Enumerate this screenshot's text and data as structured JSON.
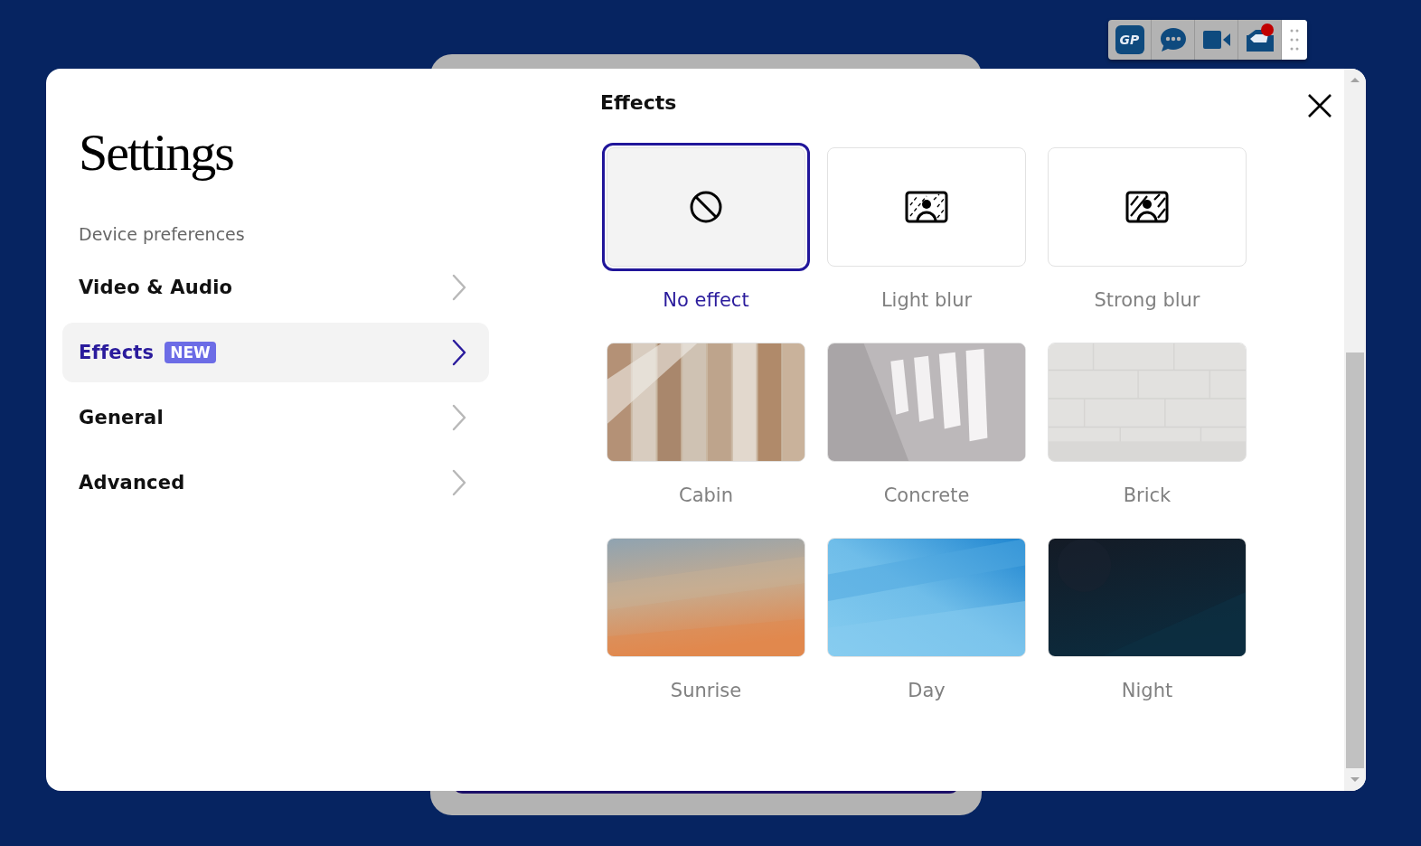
{
  "toolbar": {
    "items": [
      {
        "kind": "logo",
        "label": "GP",
        "notification": false
      },
      {
        "kind": "chat",
        "notification": false
      },
      {
        "kind": "video",
        "notification": false
      },
      {
        "kind": "inbox",
        "notification": true
      }
    ]
  },
  "settings": {
    "title": "Settings",
    "section": "Device preferences",
    "menu": [
      {
        "label": "Video & Audio",
        "selected": false
      },
      {
        "label": "Effects",
        "badge": "NEW",
        "selected": true
      },
      {
        "label": "General",
        "selected": false
      },
      {
        "label": "Advanced",
        "selected": false
      }
    ]
  },
  "effects": {
    "heading": "Effects",
    "options": [
      {
        "label": "No effect",
        "kind": "none",
        "selected": true
      },
      {
        "label": "Light blur",
        "kind": "light_blur",
        "selected": false
      },
      {
        "label": "Strong blur",
        "kind": "strong_blur",
        "selected": false
      },
      {
        "label": "Cabin",
        "kind": "picture",
        "selected": false
      },
      {
        "label": "Concrete",
        "kind": "picture",
        "selected": false
      },
      {
        "label": "Brick",
        "kind": "picture",
        "selected": false
      },
      {
        "label": "Sunrise",
        "kind": "picture",
        "selected": false
      },
      {
        "label": "Day",
        "kind": "picture",
        "selected": false
      },
      {
        "label": "Night",
        "kind": "picture",
        "selected": false
      }
    ]
  }
}
